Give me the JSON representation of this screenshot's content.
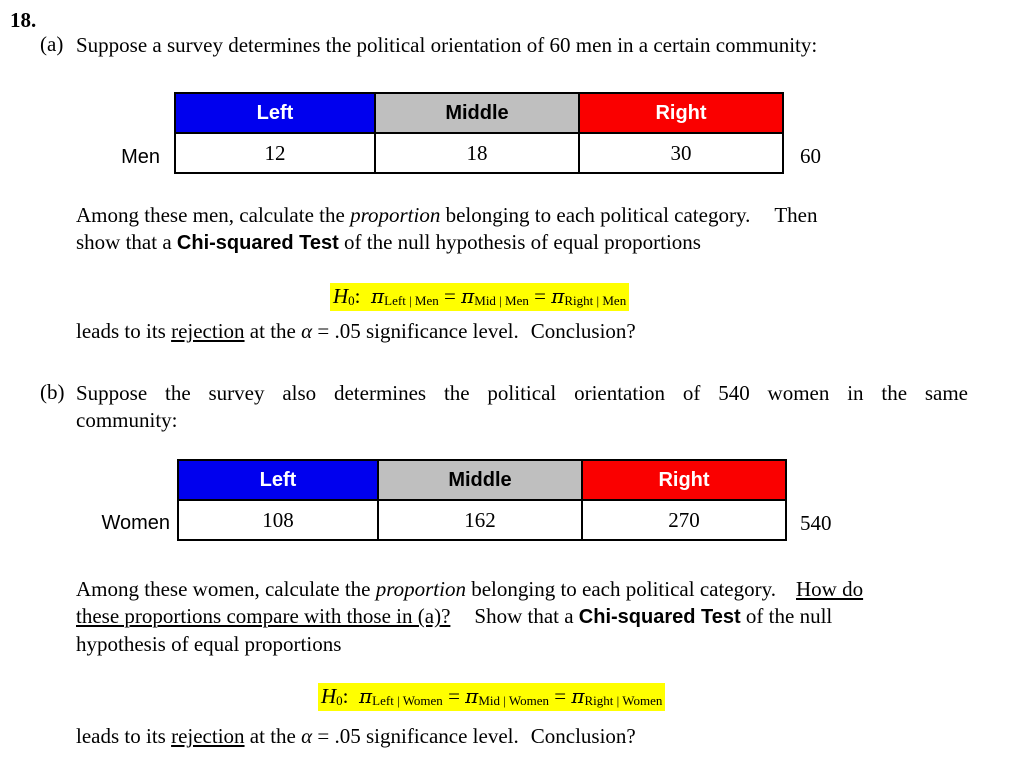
{
  "question": {
    "number": "18."
  },
  "part_a": {
    "label": "(a)",
    "prompt": "Suppose a survey determines the political orientation of 60 men in a certain community:",
    "table": {
      "row_label": "Men",
      "headers": [
        "Left",
        "Middle",
        "Right"
      ],
      "values": [
        "12",
        "18",
        "30"
      ],
      "total": "60"
    },
    "body_text_1": "Among these men, calculate the ",
    "body_italic_1": "proportion",
    "body_text_2": " belonging to each political category.",
    "body_text_3": "Then",
    "body_text_4": "show that a ",
    "body_bold_1": "Chi-squared Test",
    "body_text_5": " of the null hypothesis of equal proportions",
    "hypothesis": {
      "h0": "H",
      "h0_sub": "0",
      "colon": ":",
      "term1_sub": "Left | Men",
      "term2_sub": "Mid | Men",
      "term3_sub": "Right | Men",
      "pi": "π",
      "eq": "="
    },
    "conclusion_1": "leads to its ",
    "conclusion_underline": "rejection",
    "conclusion_2": " at the ",
    "conclusion_alpha": "α",
    "conclusion_3": " = .05 significance level.",
    "conclusion_4": "Conclusion?"
  },
  "part_b": {
    "label": "(b)",
    "prompt_line1": "Suppose the survey also determines the political orientation of 540 women in the same",
    "prompt_line2": "community:",
    "table": {
      "row_label": "Women",
      "headers": [
        "Left",
        "Middle",
        "Right"
      ],
      "values": [
        "108",
        "162",
        "270"
      ],
      "total": "540"
    },
    "body_text_1": "Among these women, calculate the ",
    "body_italic_1": "proportion",
    "body_text_2": " belonging to each political category.",
    "body_underline_1": "How do",
    "body_underline_2": "these proportions compare with those in (a)?",
    "body_text_3": "Show that a ",
    "body_bold_1": "Chi-squared Test",
    "body_text_4": " of the null",
    "body_text_5": "hypothesis of equal proportions",
    "hypothesis": {
      "h0": "H",
      "h0_sub": "0",
      "colon": ":",
      "term1_sub": "Left | Women",
      "term2_sub": "Mid | Women",
      "term3_sub": "Right | Women",
      "pi": "π",
      "eq": "="
    },
    "conclusion_1": "leads to its ",
    "conclusion_underline": "rejection",
    "conclusion_2": " at the ",
    "conclusion_alpha": "α",
    "conclusion_3": " = .05 significance level.",
    "conclusion_4": "Conclusion?"
  },
  "colors": {
    "left": "#0000ee",
    "middle": "#bfbfbf",
    "right": "#fa0000",
    "highlight": "#ffff00"
  }
}
